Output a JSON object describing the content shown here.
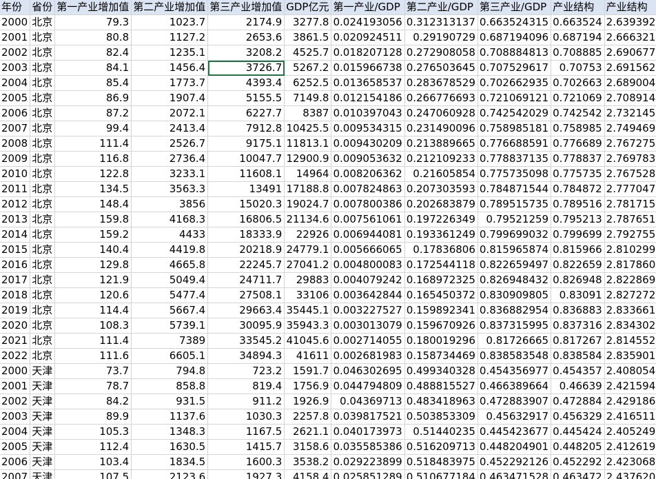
{
  "sheet": {
    "headers": [
      "年份",
      "省份",
      "第一产业增加值",
      "第二产业增加值",
      "第三产业增加值",
      "GDP亿元",
      "第一产业/GDP",
      "第二产业/GDP",
      "第三产业/GDP",
      "产业结构",
      "产业结构"
    ],
    "selected_cell": {
      "row": 3,
      "col": 4
    },
    "rows": [
      [
        "2000",
        "北京",
        "79.3",
        "1023.7",
        "2174.9",
        "3277.8",
        "0.024193056",
        "0.312313137",
        "0.663524315",
        "0.663524",
        "2.639392"
      ],
      [
        "2001",
        "北京",
        "80.8",
        "1127.2",
        "2653.6",
        "3861.5",
        "0.020924511",
        "0.29190729",
        "0.687194096",
        "0.687194",
        "2.666321"
      ],
      [
        "2002",
        "北京",
        "82.4",
        "1235.1",
        "3208.2",
        "4525.7",
        "0.018207128",
        "0.272908058",
        "0.708884813",
        "0.708885",
        "2.690677"
      ],
      [
        "2003",
        "北京",
        "84.1",
        "1456.4",
        "3726.7",
        "5267.2",
        "0.015966738",
        "0.276503645",
        "0.707529617",
        "0.70753",
        "2.691562"
      ],
      [
        "2004",
        "北京",
        "85.4",
        "1773.7",
        "4393.4",
        "6252.5",
        "0.013658537",
        "0.283678529",
        "0.702662935",
        "0.702663",
        "2.689004"
      ],
      [
        "2005",
        "北京",
        "86.9",
        "1907.4",
        "5155.5",
        "7149.8",
        "0.012154186",
        "0.266776693",
        "0.721069121",
        "0.721069",
        "2.708914"
      ],
      [
        "2006",
        "北京",
        "87.2",
        "2072.1",
        "6227.7",
        "8387",
        "0.010397043",
        "0.247060928",
        "0.742542029",
        "0.742542",
        "2.732145"
      ],
      [
        "2007",
        "北京",
        "99.4",
        "2413.4",
        "7912.8",
        "10425.5",
        "0.009534315",
        "0.231490096",
        "0.758985181",
        "0.758985",
        "2.749469"
      ],
      [
        "2008",
        "北京",
        "111.4",
        "2526.7",
        "9175.1",
        "11813.1",
        "0.009430209",
        "0.213889665",
        "0.776688591",
        "0.776689",
        "2.767275"
      ],
      [
        "2009",
        "北京",
        "116.8",
        "2736.4",
        "10047.7",
        "12900.9",
        "0.009053632",
        "0.212109233",
        "0.778837135",
        "0.778837",
        "2.769783"
      ],
      [
        "2010",
        "北京",
        "122.8",
        "3233.1",
        "11608.1",
        "14964",
        "0.008206362",
        "0.21605854",
        "0.775735098",
        "0.775735",
        "2.767528"
      ],
      [
        "2011",
        "北京",
        "134.5",
        "3563.3",
        "13491",
        "17188.8",
        "0.007824863",
        "0.207303593",
        "0.784871544",
        "0.784872",
        "2.777047"
      ],
      [
        "2012",
        "北京",
        "148.4",
        "3856",
        "15020.3",
        "19024.7",
        "0.007800386",
        "0.202683879",
        "0.789515735",
        "0.789516",
        "2.781715"
      ],
      [
        "2013",
        "北京",
        "159.8",
        "4168.3",
        "16806.5",
        "21134.6",
        "0.007561061",
        "0.197226349",
        "0.79521259",
        "0.795213",
        "2.787651"
      ],
      [
        "2014",
        "北京",
        "159.2",
        "4433",
        "18333.9",
        "22926",
        "0.006944081",
        "0.193361249",
        "0.799699032",
        "0.799699",
        "2.792755"
      ],
      [
        "2015",
        "北京",
        "140.4",
        "4419.8",
        "20218.9",
        "24779.1",
        "0.005666065",
        "0.17836806",
        "0.815965874",
        "0.815966",
        "2.810299"
      ],
      [
        "2016",
        "北京",
        "129.8",
        "4665.8",
        "22245.7",
        "27041.2",
        "0.004800083",
        "0.172544118",
        "0.822659497",
        "0.822659",
        "2.817860"
      ],
      [
        "2017",
        "北京",
        "121.9",
        "5049.4",
        "24711.7",
        "29883",
        "0.004079242",
        "0.168972325",
        "0.826948432",
        "0.826948",
        "2.822869"
      ],
      [
        "2018",
        "北京",
        "120.6",
        "5477.4",
        "27508.1",
        "33106",
        "0.003642844",
        "0.165450372",
        "0.830909805",
        "0.83091",
        "2.827272"
      ],
      [
        "2019",
        "北京",
        "114.4",
        "5667.4",
        "29663.4",
        "35445.1",
        "0.003227527",
        "0.159892341",
        "0.836882954",
        "0.836883",
        "2.833661"
      ],
      [
        "2020",
        "北京",
        "108.3",
        "5739.1",
        "30095.9",
        "35943.3",
        "0.003013079",
        "0.159670926",
        "0.837315995",
        "0.837316",
        "2.834302"
      ],
      [
        "2021",
        "北京",
        "111.4",
        "7389",
        "33545.2",
        "41045.6",
        "0.002714055",
        "0.180019296",
        "0.81726665",
        "0.817267",
        "2.814552"
      ],
      [
        "2022",
        "北京",
        "111.6",
        "6605.1",
        "34894.3",
        "41611",
        "0.002681983",
        "0.158734469",
        "0.838583548",
        "0.838584",
        "2.835901"
      ],
      [
        "2000",
        "天津",
        "73.7",
        "794.8",
        "723.2",
        "1591.7",
        "0.046302695",
        "0.499340328",
        "0.454356977",
        "0.454357",
        "2.408054"
      ],
      [
        "2001",
        "天津",
        "78.7",
        "858.8",
        "819.4",
        "1756.9",
        "0.044794809",
        "0.488815527",
        "0.466389664",
        "0.46639",
        "2.421594"
      ],
      [
        "2002",
        "天津",
        "84.2",
        "931.5",
        "911.2",
        "1926.9",
        "0.04369713",
        "0.483418963",
        "0.472883907",
        "0.472884",
        "2.429186"
      ],
      [
        "2003",
        "天津",
        "89.9",
        "1137.6",
        "1030.3",
        "2257.8",
        "0.039817521",
        "0.503853309",
        "0.45632917",
        "0.456329",
        "2.416511"
      ],
      [
        "2004",
        "天津",
        "105.3",
        "1348.3",
        "1167.5",
        "2621.1",
        "0.040173973",
        "0.51440235",
        "0.445423677",
        "0.445424",
        "2.405249"
      ],
      [
        "2005",
        "天津",
        "112.4",
        "1630.5",
        "1415.7",
        "3158.6",
        "0.035585386",
        "0.516209713",
        "0.448204901",
        "0.448205",
        "2.412619"
      ],
      [
        "2006",
        "天津",
        "103.4",
        "1834.5",
        "1600.3",
        "3538.2",
        "0.029223899",
        "0.518483975",
        "0.452292126",
        "0.452292",
        "2.423068"
      ],
      [
        "2007",
        "天津",
        "107.5",
        "2123.6",
        "1927.3",
        "4158.4",
        "0.025851289",
        "0.510677184",
        "0.463471528",
        "0.463472",
        "2.437620"
      ]
    ]
  }
}
